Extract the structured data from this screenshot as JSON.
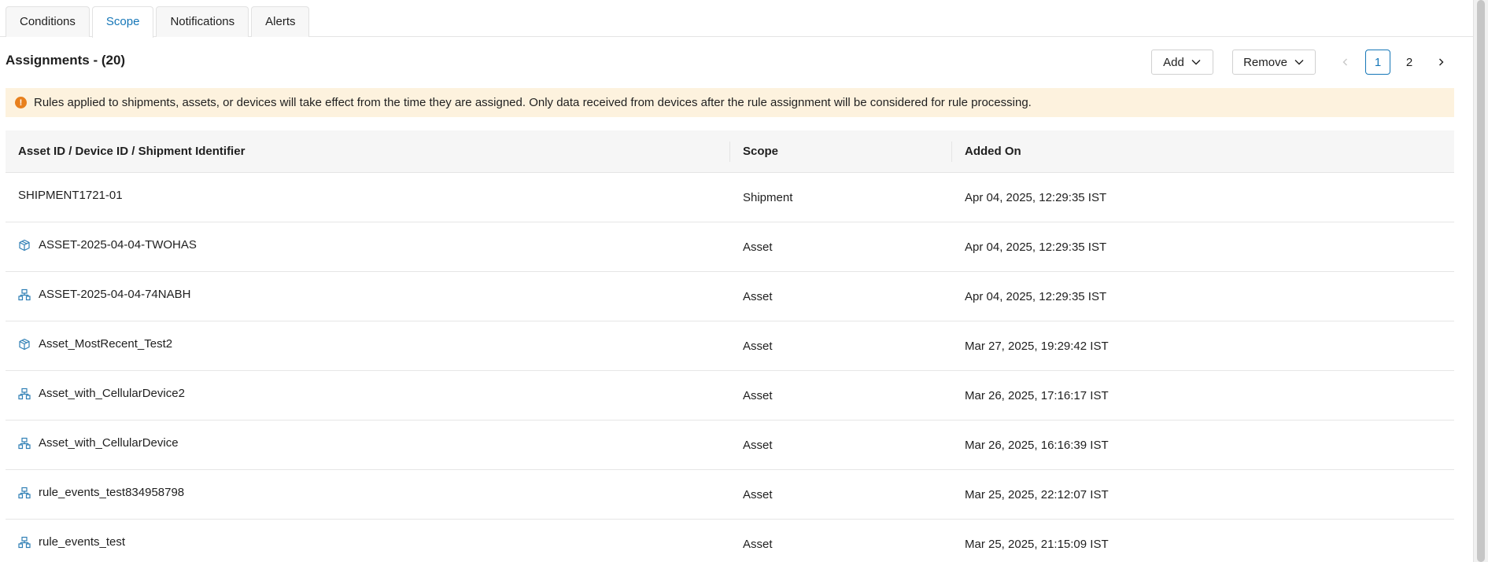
{
  "tabs": [
    {
      "label": "Conditions",
      "active": false
    },
    {
      "label": "Scope",
      "active": true
    },
    {
      "label": "Notifications",
      "active": false
    },
    {
      "label": "Alerts",
      "active": false
    }
  ],
  "header": {
    "title": "Assignments - (20)",
    "add_label": "Add",
    "remove_label": "Remove"
  },
  "pagination": {
    "prev_icon": "chevron-left-icon",
    "pages": [
      "1",
      "2"
    ],
    "current_page": "1",
    "next_icon": "chevron-right-icon"
  },
  "alert": {
    "icon": "exclamation-circle-icon",
    "text": "Rules applied to shipments, assets, or devices will take effect from the time they are assigned. Only data received from devices after the rule assignment will be considered for rule processing."
  },
  "table": {
    "columns": [
      "Asset ID / Device ID / Shipment Identifier",
      "Scope",
      "Added On"
    ],
    "rows": [
      {
        "icon": "none",
        "id": "SHIPMENT1721-01",
        "scope": "Shipment",
        "added_on": "Apr 04, 2025, 12:29:35 IST"
      },
      {
        "icon": "box-icon",
        "id": "ASSET-2025-04-04-TWOHAS",
        "scope": "Asset",
        "added_on": "Apr 04, 2025, 12:29:35 IST"
      },
      {
        "icon": "linked-devices-icon",
        "id": "ASSET-2025-04-04-74NABH",
        "scope": "Asset",
        "added_on": "Apr 04, 2025, 12:29:35 IST"
      },
      {
        "icon": "box-icon",
        "id": "Asset_MostRecent_Test2",
        "scope": "Asset",
        "added_on": "Mar 27, 2025, 19:29:42 IST"
      },
      {
        "icon": "linked-devices-icon",
        "id": "Asset_with_CellularDevice2",
        "scope": "Asset",
        "added_on": "Mar 26, 2025, 17:16:17 IST"
      },
      {
        "icon": "linked-devices-icon",
        "id": "Asset_with_CellularDevice",
        "scope": "Asset",
        "added_on": "Mar 26, 2025, 16:16:39 IST"
      },
      {
        "icon": "linked-devices-icon",
        "id": "rule_events_test834958798",
        "scope": "Asset",
        "added_on": "Mar 25, 2025, 22:12:07 IST"
      },
      {
        "icon": "linked-devices-icon",
        "id": "rule_events_test",
        "scope": "Asset",
        "added_on": "Mar 25, 2025, 21:15:09 IST"
      }
    ]
  },
  "colors": {
    "accent": "#1677b8",
    "alert_bg": "#fdf2de",
    "alert_icon": "#e8801d",
    "row_icon": "#2f7fb5"
  }
}
